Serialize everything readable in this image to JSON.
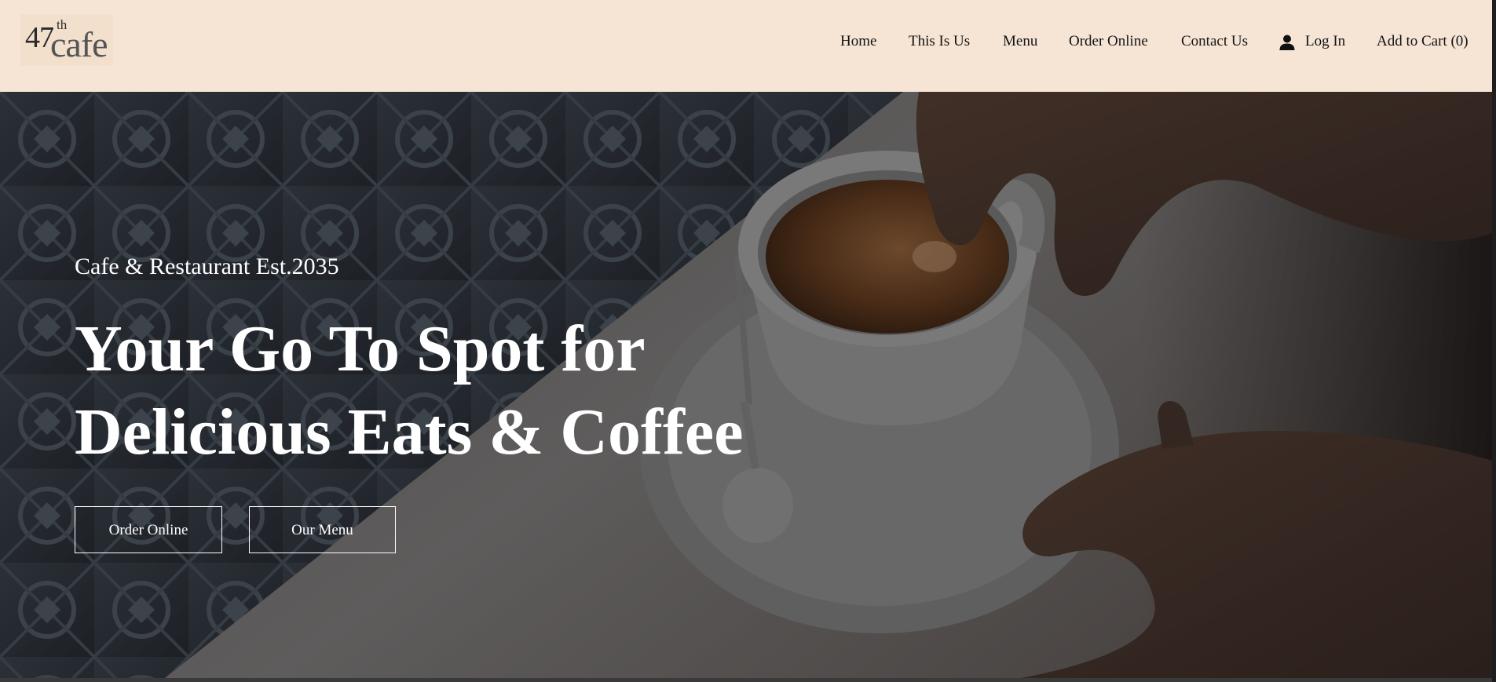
{
  "brand": {
    "logo_number": "47",
    "logo_superscript": "th",
    "logo_word": "cafe"
  },
  "nav": {
    "home": "Home",
    "about": "This Is Us",
    "menu": "Menu",
    "order": "Order Online",
    "contact": "Contact Us",
    "login": "Log In",
    "cart": "Add to Cart (0)"
  },
  "hero": {
    "subtitle": "Cafe & Restaurant Est.2035",
    "title_line1": "Your Go To Spot for",
    "title_line2": "Delicious Eats & Coffee",
    "order_button": "Order Online",
    "menu_button": "Our Menu"
  },
  "colors": {
    "header_bg": "#f6e5d5",
    "hero_text": "#ffffff"
  },
  "icons": {
    "login": "user-icon"
  }
}
